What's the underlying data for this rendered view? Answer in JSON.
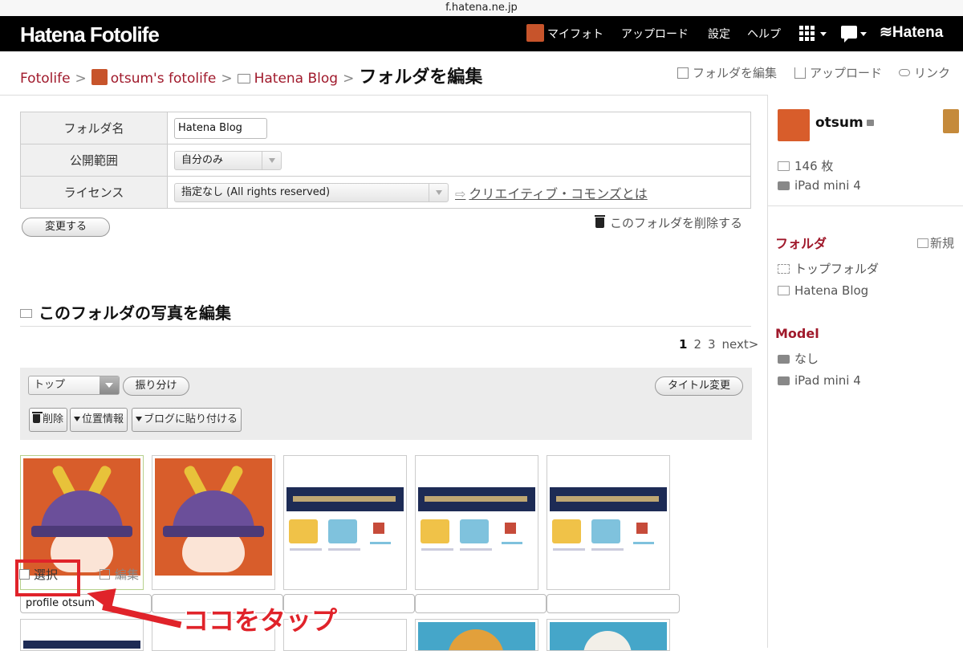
{
  "browser": {
    "url": "f.hatena.ne.jp"
  },
  "header": {
    "logo": "Hatena Fotolife",
    "nav": [
      "マイフォト",
      "アップロード",
      "設定",
      "ヘルプ"
    ],
    "brand": "Hatena"
  },
  "breadcrumb": {
    "items": [
      "Fotolife",
      "otsum's fotolife",
      "Hatena Blog"
    ],
    "separator": ">",
    "title": "フォルダを編集"
  },
  "top_actions": [
    "フォルダを編集",
    "アップロード",
    "リンク"
  ],
  "form": {
    "folder_name_label": "フォルダ名",
    "folder_name_value": "Hatena Blog",
    "visibility_label": "公開範囲",
    "visibility_value": "自分のみ",
    "license_label": "ライセンス",
    "license_value": "指定なし (All rights reserved)",
    "cc_link": "クリエイティブ・コモンズとは",
    "submit": "変更する",
    "delete_folder": "このフォルダを削除する"
  },
  "photos_section": {
    "title": "このフォルダの写真を編集",
    "pages": [
      "1",
      "2",
      "3"
    ],
    "current_page": "1",
    "next": "next>"
  },
  "toolbar": {
    "move_select": "トップ",
    "sort_button": "振り分け",
    "retitle_button": "タイトル変更",
    "delete_button": "削除",
    "location_button": "位置情報",
    "blog_paste_button": "ブログに貼り付ける"
  },
  "thumbnail": {
    "select_label": "選択",
    "edit_label": "編集",
    "caption_first": "profile otsum"
  },
  "annotation": {
    "text": "ココをタップ",
    "color": "#e0232a"
  },
  "sidebar": {
    "user": "otsum",
    "photo_count": "146 枚",
    "device": "iPad mini 4",
    "folder_heading": "フォルダ",
    "new_folder": "新規",
    "folders": [
      "トップフォルダ",
      "Hatena Blog"
    ],
    "model_heading": "Model",
    "models": [
      "なし",
      "iPad mini 4"
    ]
  },
  "colors": {
    "accent": "#a0192b",
    "header_bg": "#000000"
  }
}
